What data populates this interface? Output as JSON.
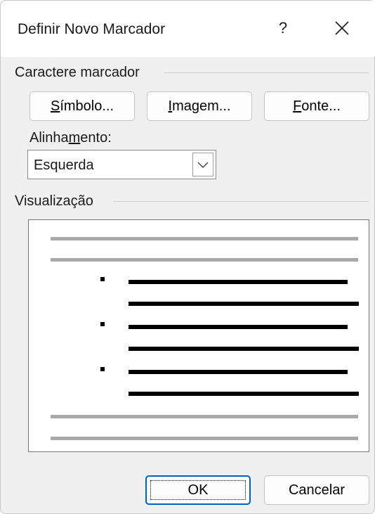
{
  "dialog": {
    "title": "Definir Novo Marcador",
    "help_label": "?",
    "close_label": "✕"
  },
  "bullet_character": {
    "group_label": "Caractere marcador",
    "symbol_button": {
      "first": "S",
      "rest": "ímbolo..."
    },
    "image_button": {
      "first": "I",
      "rest": "magem..."
    },
    "font_button": {
      "first": "F",
      "rest": "onte..."
    }
  },
  "alignment": {
    "label_pre": "Alinha",
    "label_accel": "m",
    "label_post": "ento:",
    "selected": "Esquerda"
  },
  "preview": {
    "group_label": "Visualização"
  },
  "footer": {
    "ok_label": "OK",
    "cancel_label": "Cancelar"
  }
}
